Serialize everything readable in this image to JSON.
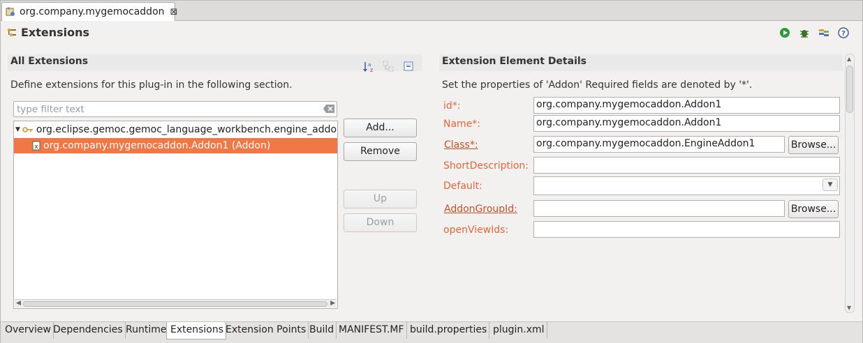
{
  "editor": {
    "tab_title": "org.company.mygemocaddon",
    "close_glyph": "⊠"
  },
  "page": {
    "title": "Extensions",
    "actions": [
      {
        "name": "run-icon",
        "color": "#2e9a3a"
      },
      {
        "name": "debug-icon",
        "color": "#3c6e2c"
      },
      {
        "name": "export-icon",
        "color": "#5a6fb0"
      },
      {
        "name": "help-icon",
        "color": "#3d5e9a"
      }
    ]
  },
  "all_extensions": {
    "heading": "All Extensions",
    "description": "Define extensions for this plug-in in the following section.",
    "filter_placeholder": "type filter text",
    "tree": [
      {
        "label": "org.eclipse.gemoc.gemoc_language_workbench.engine_addon",
        "icon": "extension-point-icon",
        "expanded": true,
        "selected": false
      },
      {
        "label": "org.company.mygemocaddon.Addon1 (Addon)",
        "icon": "element-icon",
        "selected": true
      }
    ],
    "buttons": {
      "add": "Add...",
      "remove": "Remove",
      "up": "Up",
      "down": "Down"
    }
  },
  "details": {
    "heading": "Extension Element Details",
    "description": "Set the properties of 'Addon' Required fields are denoted by '*'.",
    "fields": {
      "id": {
        "label": "id*:",
        "value": "org.company.mygemocaddon.Addon1"
      },
      "name": {
        "label": "Name*:",
        "value": "org.company.mygemocaddon.Addon1"
      },
      "class": {
        "label": "Class*:",
        "value": "org.company.mygemocaddon.EngineAddon1",
        "browse": "Browse..."
      },
      "short_description": {
        "label": "ShortDescription:",
        "value": ""
      },
      "default": {
        "label": "Default:",
        "value": ""
      },
      "addon_group_id": {
        "label": "AddonGroupId:",
        "value": "",
        "browse": "Browse..."
      },
      "open_view_ids": {
        "label": "openViewIds:",
        "value": ""
      }
    }
  },
  "page_tabs": [
    "Overview",
    "Dependencies",
    "Runtime",
    "Extensions",
    "Extension Points",
    "Build",
    "MANIFEST.MF",
    "build.properties",
    "plugin.xml"
  ],
  "active_page_tab": "Extensions",
  "colors": {
    "selection": "#f07746",
    "label": "#e0663a"
  }
}
